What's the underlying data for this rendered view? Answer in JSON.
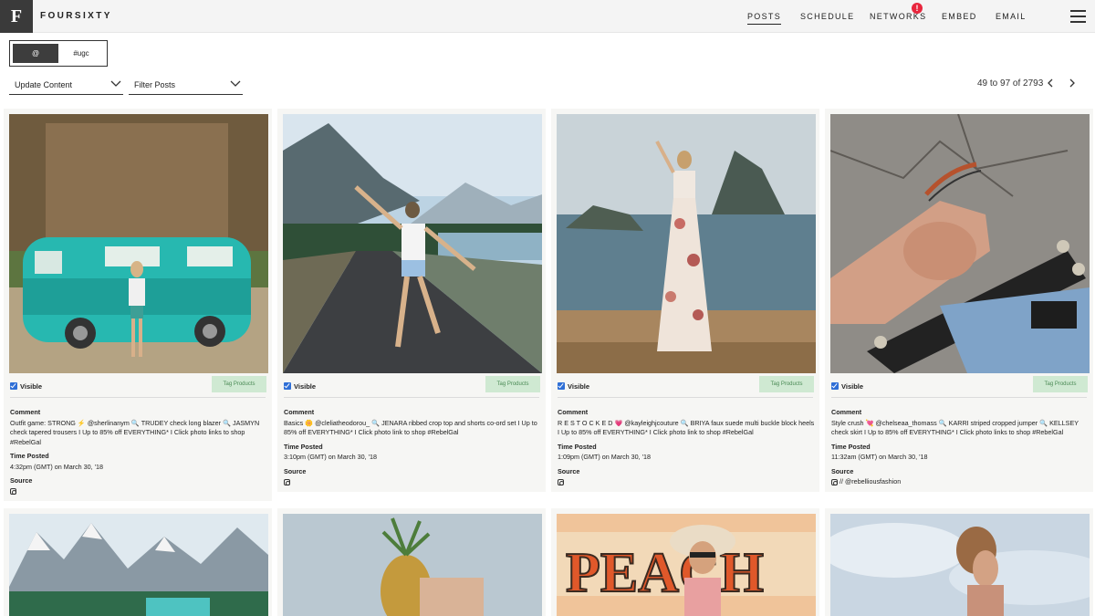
{
  "brand": {
    "logo_letter": "F",
    "name": "FOURSIXTY"
  },
  "nav": {
    "posts": "POSTS",
    "schedule": "SCHEDULE",
    "networks": "NETWORKS",
    "networks_badge": "!",
    "embed": "EMBED",
    "email": "EMAIL"
  },
  "toggle": {
    "at": "@",
    "ugc": "#ugc"
  },
  "filters": {
    "update": "Update Content",
    "filter": "Filter Posts"
  },
  "pager": {
    "text": "49 to 97 of 2793"
  },
  "labels": {
    "visible": "Visible",
    "tag_products": "Tag Products",
    "comment": "Comment",
    "time_posted": "Time Posted",
    "source": "Source"
  },
  "posts": [
    {
      "comment": "Outfit game: STRONG ⚡ @sherlinanym 🔍 TRUDEY check long blazer 🔍 JASMYN check tapered trousers I Up to 85% off EVERYTHING* I Click photo links to shop #RebelGal",
      "time": "4:32pm (GMT) on March 30, '18",
      "source": ""
    },
    {
      "comment": "Basics 🌼 @cleliatheodorou_ 🔍 JENARA ribbed crop top and shorts co-ord set I Up to 85% off EVERYTHING* I Click photo link to shop #RebelGal",
      "time": "3:10pm (GMT) on March 30, '18",
      "source": ""
    },
    {
      "comment": "R E S T O C K E D 💗 @kayleighjcouture 🔍 BRIYA faux suede multi buckle block heels I Up to 85% off EVERYTHING* I Click photo link to shop #RebelGal",
      "time": "1:09pm (GMT) on March 30, '18",
      "source": ""
    },
    {
      "comment": "Style crush 💘 @chelseaa_thomass 🔍 KARRI striped cropped jumper 🔍 KELLSEY check skirt I Up to 85% off EVERYTHING* I Click photo links to shop #RebelGal",
      "time": "11:32am (GMT) on March 30, '18",
      "source": "// @rebelliousfashion"
    }
  ]
}
